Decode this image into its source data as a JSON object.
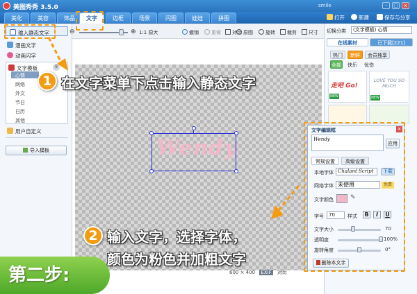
{
  "app": {
    "title": "美图秀秀 3.5.0",
    "user": "smile"
  },
  "window_controls": [
    "-",
    "□",
    "x"
  ],
  "menu": {
    "tabs": [
      "美化",
      "美容",
      "饰品",
      "文字",
      "边框",
      "场景",
      "闪图",
      "娃娃",
      "拼图"
    ],
    "active_tab": "文字",
    "right_tools": {
      "open": "打开",
      "new": "新建",
      "save": "保存与分享"
    }
  },
  "sidebar": {
    "static_text": "输入静态文字",
    "dynamic_text": "动画闪字",
    "doodle_text": "漫画文字",
    "template_text": "文字模板",
    "template_badge": "8",
    "subitems": [
      "心情",
      "网络",
      "外文",
      "节日",
      "日历",
      "其他"
    ],
    "selected_sub": "心情",
    "user_custom": "用户自定义",
    "import_button": "导入模板"
  },
  "toolbar": {
    "original_size": "1:1 原大",
    "undo": "撤销",
    "redo": "重做",
    "compare": "对比",
    "original_image": "原图",
    "rotate": "旋转",
    "crop": "裁剪",
    "size": "尺寸",
    "zoom_fraction": 0.85
  },
  "canvas": {
    "text": "Wendy",
    "dimensions": "600 × 400",
    "exif": "EXIF",
    "compare_label": "对比"
  },
  "right_panel": {
    "switch_label": "切换分类",
    "category_select": "(文字模板) 心情",
    "online_tab": "在线素材",
    "download_tab": "已下载[221]",
    "filter_hot": "热门",
    "filter_new": "新鲜",
    "filter_vip": "会员独享",
    "filter_all": "全部",
    "filter_fast": "快乐",
    "filter_sad": "忧伤",
    "thumb_text_1": "走吧 Go!",
    "thumb_text_2": "LOVE YOU SO MUCH",
    "new_badge": "NEW"
  },
  "editor": {
    "title": "文字编辑框",
    "input_value": "Wendy",
    "apply": "应用",
    "tab_normal": "常规设置",
    "tab_advanced": "高级设置",
    "local_font_label": "本地字体",
    "local_font_value": "Chalant Script",
    "download_button": "下载",
    "web_font_label": "网络字体",
    "web_font_value": "未使用",
    "free_badge": "免费",
    "color_label": "文字颜色",
    "text_color": "#f2b8c8",
    "size_label": "字号",
    "size_value": "70",
    "style_label": "样式",
    "bold": "B",
    "italic": "I",
    "underline": "U",
    "textsize_label": "文字大小",
    "textsize_value": "70",
    "opacity_label": "透明度",
    "opacity_value": "100%",
    "rotate_label": "旋转角度",
    "rotate_value": "0°",
    "delete_button": "删除本文字",
    "textsize_fraction": 0.35,
    "opacity_fraction": 1.0,
    "rotate_fraction": 0.5
  },
  "annotations": {
    "step1_number": "1",
    "step1_text": "在文字菜单下点击输入静态文字",
    "step2_number": "2",
    "step2_line1": "输入文字，选择字体，",
    "step2_line2": "颜色为粉色并加粗文字",
    "step_label": "第二步:",
    "accent_color": "#f39c12"
  }
}
